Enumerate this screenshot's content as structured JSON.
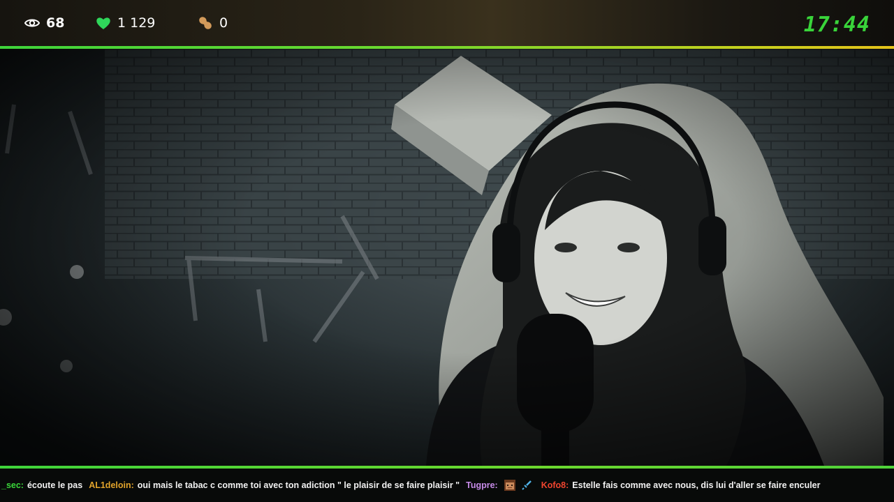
{
  "stream_stats": {
    "viewer_count": "68",
    "like_count": "1 129",
    "peanut_count": "0",
    "clock": "17:44"
  },
  "icons": {
    "viewers": "eye-icon",
    "likes": "heart-icon",
    "peanuts": "peanut-icon",
    "emote": "pixel-face-emote-icon",
    "sword": "sword-icon"
  },
  "colors": {
    "accent_green": "#39d43a",
    "heart_green": "#2fd65a",
    "peanut": "#d29a5a"
  },
  "chat_ticker": {
    "messages": [
      {
        "user": "_sec:",
        "text": "écoute le pas"
      },
      {
        "user": "AL1deloin:",
        "text": "oui mais le tabac c comme toi avec ton adiction \" le plaisir de se faire plaisir \""
      },
      {
        "user": "Tugpre:",
        "text": ""
      },
      {
        "user": "Kofo8:",
        "text": "Estelle fais comme avec nous, dis lui d'aller se faire enculer"
      }
    ]
  }
}
